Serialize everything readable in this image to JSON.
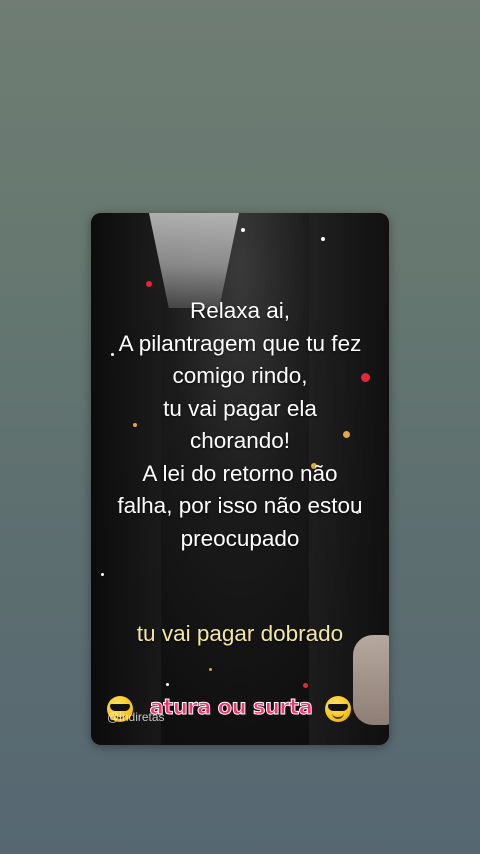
{
  "post": {
    "quote_lines": [
      "Relaxa ai,",
      "A pilantragem que tu fez",
      "comigo rindo,",
      "tu vai pagar ela",
      "chorando!",
      "A lei do retorno não",
      "falha, por isso não estou",
      "preocupado"
    ],
    "highlight": "tu vai pagar dobrado",
    "signature": "atura ou surta",
    "watermark": "@indiretas",
    "emoji_left": "smiling-face-with-sunglasses-icon",
    "emoji_right": "smiling-face-with-sunglasses-icon"
  },
  "colors": {
    "highlight": "#f3e7a8",
    "signature": "#ff2f6b",
    "background_top": "#6f7d74",
    "background_bottom": "#566772"
  }
}
